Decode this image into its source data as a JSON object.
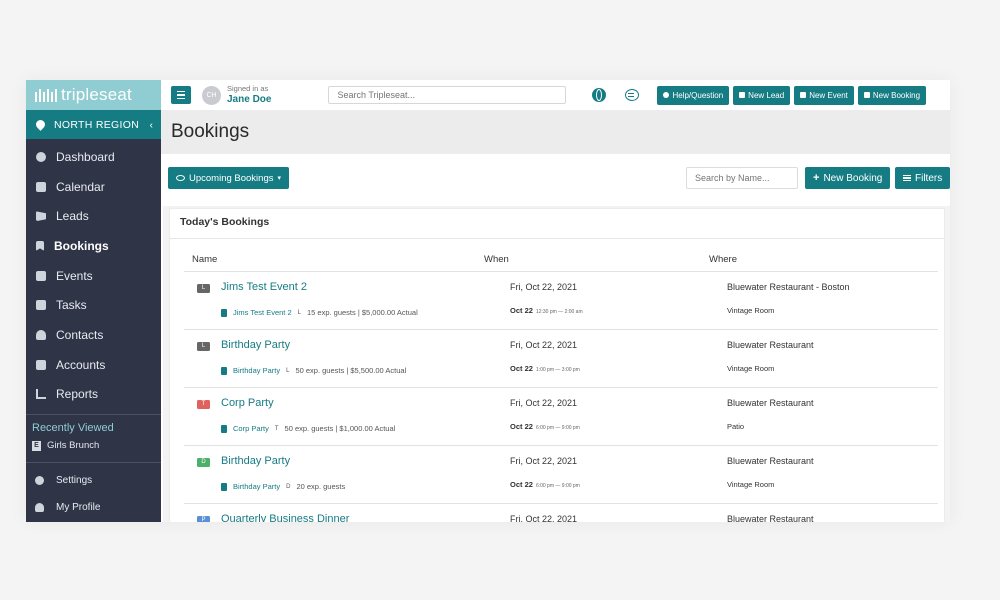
{
  "brand": {
    "name": "tripleseat"
  },
  "region": {
    "label": "NORTH REGION",
    "collapse_glyph": "‹"
  },
  "sidebar": {
    "items": [
      {
        "label": "Dashboard",
        "icon": "gauge-icon"
      },
      {
        "label": "Calendar",
        "icon": "calendar-icon"
      },
      {
        "label": "Leads",
        "icon": "megaphone-icon"
      },
      {
        "label": "Bookings",
        "icon": "bookmark-icon"
      },
      {
        "label": "Events",
        "icon": "book-icon"
      },
      {
        "label": "Tasks",
        "icon": "checkbox-icon"
      },
      {
        "label": "Contacts",
        "icon": "people-icon"
      },
      {
        "label": "Accounts",
        "icon": "building-icon"
      },
      {
        "label": "Reports",
        "icon": "chart-icon"
      }
    ],
    "recent_title": "Recently Viewed",
    "recent_items": [
      {
        "badge": "E",
        "label": "Girls Brunch"
      }
    ],
    "bottom_items": [
      {
        "label": "Settings",
        "icon": "gear-icon"
      },
      {
        "label": "My Profile",
        "icon": "person-icon"
      }
    ]
  },
  "topbar": {
    "avatar_initials": "CH",
    "signed_in_label": "Signed in as",
    "user_name": "Jane Doe",
    "search_placeholder": "Search Tripleseat...",
    "buttons": [
      "Help/Question",
      "New Lead",
      "New Event",
      "New Booking"
    ]
  },
  "page": {
    "title": "Bookings"
  },
  "toolbar": {
    "upcoming_label": "Upcoming Bookings",
    "search_placeholder": "Search by Name...",
    "new_booking_label": "New Booking",
    "filters_label": "Filters"
  },
  "todays": {
    "title": "Today's Bookings",
    "columns": [
      "Name",
      "When",
      "Where"
    ],
    "rows": [
      {
        "badge": "L",
        "badge_color": "#666666",
        "name": "Jims Test Event 2",
        "sub_link": "Jims Test Event 2",
        "sub_code": "L",
        "sub_detail": "15 exp. guests | $5,000.00 Actual",
        "date": "Fri, Oct 22, 2021",
        "time_day": "Oct 22",
        "time_range": "12:30 pm — 2:00 am",
        "venue": "Bluewater Restaurant - Boston",
        "room": "Vintage Room"
      },
      {
        "badge": "L",
        "badge_color": "#666666",
        "name": "Birthday Party",
        "sub_link": "Birthday Party",
        "sub_code": "L",
        "sub_detail": "50 exp. guests | $5,500.00 Actual",
        "date": "Fri, Oct 22, 2021",
        "time_day": "Oct 22",
        "time_range": "1:00 pm — 3:00 pm",
        "venue": "Bluewater Restaurant",
        "room": "Vintage Room"
      },
      {
        "badge": "T",
        "badge_color": "#e0625f",
        "name": "Corp Party",
        "sub_link": "Corp Party",
        "sub_code": "T",
        "sub_detail": "50 exp. guests | $1,000.00 Actual",
        "date": "Fri, Oct 22, 2021",
        "time_day": "Oct 22",
        "time_range": "6:00 pm — 9:00 pm",
        "venue": "Bluewater Restaurant",
        "room": "Patio"
      },
      {
        "badge": "D",
        "badge_color": "#4caf6a",
        "name": "Birthday Party",
        "sub_link": "Birthday Party",
        "sub_code": "D",
        "sub_detail": "20 exp. guests",
        "date": "Fri, Oct 22, 2021",
        "time_day": "Oct 22",
        "time_range": "6:00 pm — 9:00 pm",
        "venue": "Bluewater Restaurant",
        "room": "Vintage Room"
      },
      {
        "badge": "P",
        "badge_color": "#5b8fd6",
        "name": "Quarterly Business Dinner",
        "sub_link": "",
        "sub_code": "",
        "sub_detail": "",
        "date": "Fri, Oct 22, 2021",
        "time_day": "",
        "time_range": "",
        "venue": "Bluewater Restaurant",
        "room": ""
      }
    ]
  },
  "colors": {
    "accent": "#167c84",
    "sidebar_bg": "#2f3447",
    "logo_bg": "#8fcdd3"
  }
}
